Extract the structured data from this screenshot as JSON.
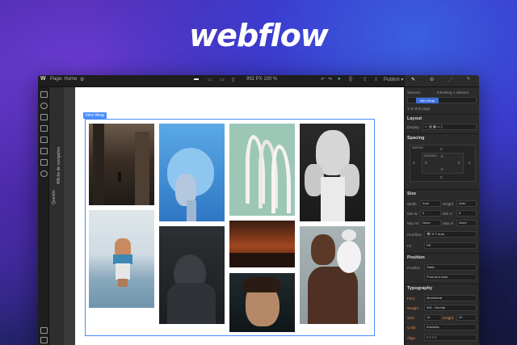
{
  "brand": {
    "logo_text": "webflow"
  },
  "topbar": {
    "page_label": "Page: Home",
    "dimensions": "992 PX  100 %",
    "logo_glyph": "W"
  },
  "navigator": {
    "vertical_labels": [
      "Quentin",
      "Affiche de navigation"
    ]
  },
  "canvas": {
    "wrapper_label": "Intro Wrap"
  },
  "right_panel": {
    "selector_label": "Selector",
    "selector_info": "Inheriting 1 selector",
    "class_chip": "Intro Wrap",
    "on_page": "1 on this page",
    "sections": {
      "layout": "Layout",
      "spacing": "Spacing",
      "size": "Size",
      "position": "Position",
      "typography": "Typography"
    },
    "layout": {
      "display_label": "Display"
    },
    "spacing": {
      "margin_label": "MARGIN",
      "padding_label": "PADDING",
      "values": [
        "0",
        "0",
        "0",
        "0",
        "0",
        "0",
        "0",
        "0"
      ]
    },
    "size": {
      "width_label": "Width",
      "width_val": "Auto",
      "height_label": "Height",
      "height_val": "Auto",
      "minw_label": "Min W",
      "minw_val": "0",
      "minh_label": "Min H",
      "minh_val": "0",
      "maxw_label": "Max W",
      "maxw_val": "None",
      "maxh_label": "Max H",
      "maxh_val": "None",
      "overflow_label": "Overflow",
      "fit_label": "Fit",
      "fit_val": "Fill"
    },
    "position": {
      "position_label": "Position",
      "position_val": "Static",
      "float_label": "Float and clear"
    },
    "typography": {
      "font_label": "Font",
      "font_val": "Montserrat",
      "weight_label": "Weight",
      "weight_val": "400 - Normal",
      "size_label": "Size",
      "size_val": "14",
      "height_label": "Height",
      "height_val": "20",
      "color_label": "Color",
      "color_val": "#3a3a3a",
      "align_label": "Align"
    }
  },
  "colors": {
    "accent": "#4a8cff",
    "highlight": "#e88a4a",
    "green": "#3ecf6a"
  }
}
